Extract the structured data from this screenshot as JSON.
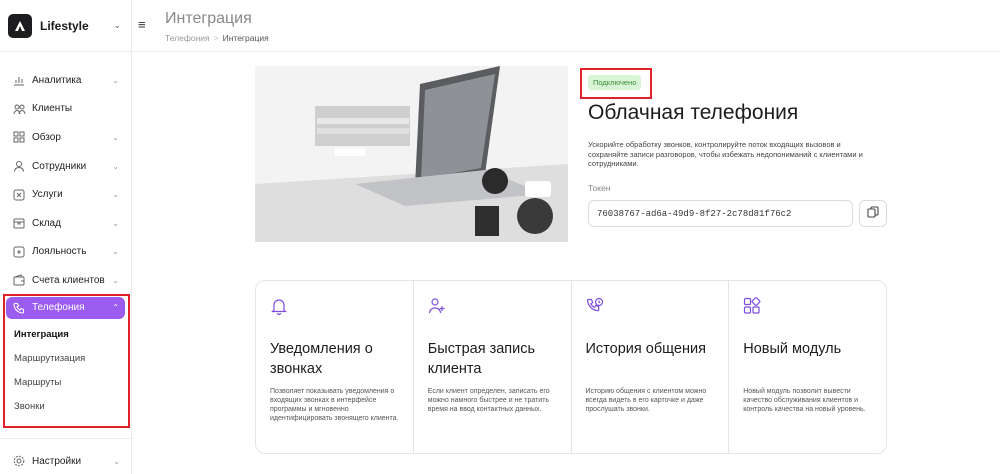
{
  "brand": {
    "name": "Lifestyle"
  },
  "sidebar": {
    "items": [
      {
        "label": "Аналитика",
        "icon": "chart-icon",
        "chevron": true
      },
      {
        "label": "Клиенты",
        "icon": "users-icon",
        "chevron": false
      },
      {
        "label": "Обзор",
        "icon": "grid-icon",
        "chevron": true
      },
      {
        "label": "Сотрудники",
        "icon": "user-icon",
        "chevron": true
      },
      {
        "label": "Услуги",
        "icon": "services-icon",
        "chevron": true
      },
      {
        "label": "Склад",
        "icon": "box-icon",
        "chevron": true
      },
      {
        "label": "Лояльность",
        "icon": "loyalty-icon",
        "chevron": true
      },
      {
        "label": "Счета клиентов",
        "icon": "wallet-icon",
        "chevron": true
      }
    ],
    "active": {
      "label": "Телефония",
      "icon": "phone-icon"
    },
    "subitems": [
      "Интеграция",
      "Маршрутизация",
      "Маршруты",
      "Звонки"
    ],
    "bottom": {
      "label": "Настройки",
      "icon": "settings-icon"
    }
  },
  "header": {
    "title": "Интеграция",
    "breadcrumb": [
      "Телефония",
      "Интеграция"
    ]
  },
  "hero": {
    "badge": "Подключено",
    "title": "Облачная телефония",
    "description": "Ускорийте обработку звонков, контролируйте поток входящих вызовов и сохраняйте записи разговоров, чтобы избежать недопониманий с клиентами и сотрудниками.",
    "token_label": "Токен",
    "token_value": "76038767-ad6a-49d9-8f27-2c78d81f76c2"
  },
  "cards": [
    {
      "icon": "bell-icon",
      "title": "Уведомления о звонках",
      "desc": "Позволяет показывать уведомления о входящих звонках в интерфейсе программы и мгновенно идентифицировать звонящего клиента."
    },
    {
      "icon": "user-plus-icon",
      "title": "Быстрая запись клиента",
      "desc": "Если клиент определен, записать его можно намного быстрее и не тратить время на ввод контактных данных."
    },
    {
      "icon": "phone-history-icon",
      "title": "История общения",
      "desc": "Историю общения с клиентом можно всегда видеть в его карточке и даже прослушать звонки."
    },
    {
      "icon": "modules-icon",
      "title": "Новый модуль",
      "desc": "Новый модуль позволит вывести качество обслуживания клиентов и контроль качества на новый уровень."
    }
  ],
  "colors": {
    "accent": "#9b5cf0",
    "badge_bg": "#d9f5d6",
    "badge_text": "#3a8c35",
    "highlight": "#e0202a"
  }
}
